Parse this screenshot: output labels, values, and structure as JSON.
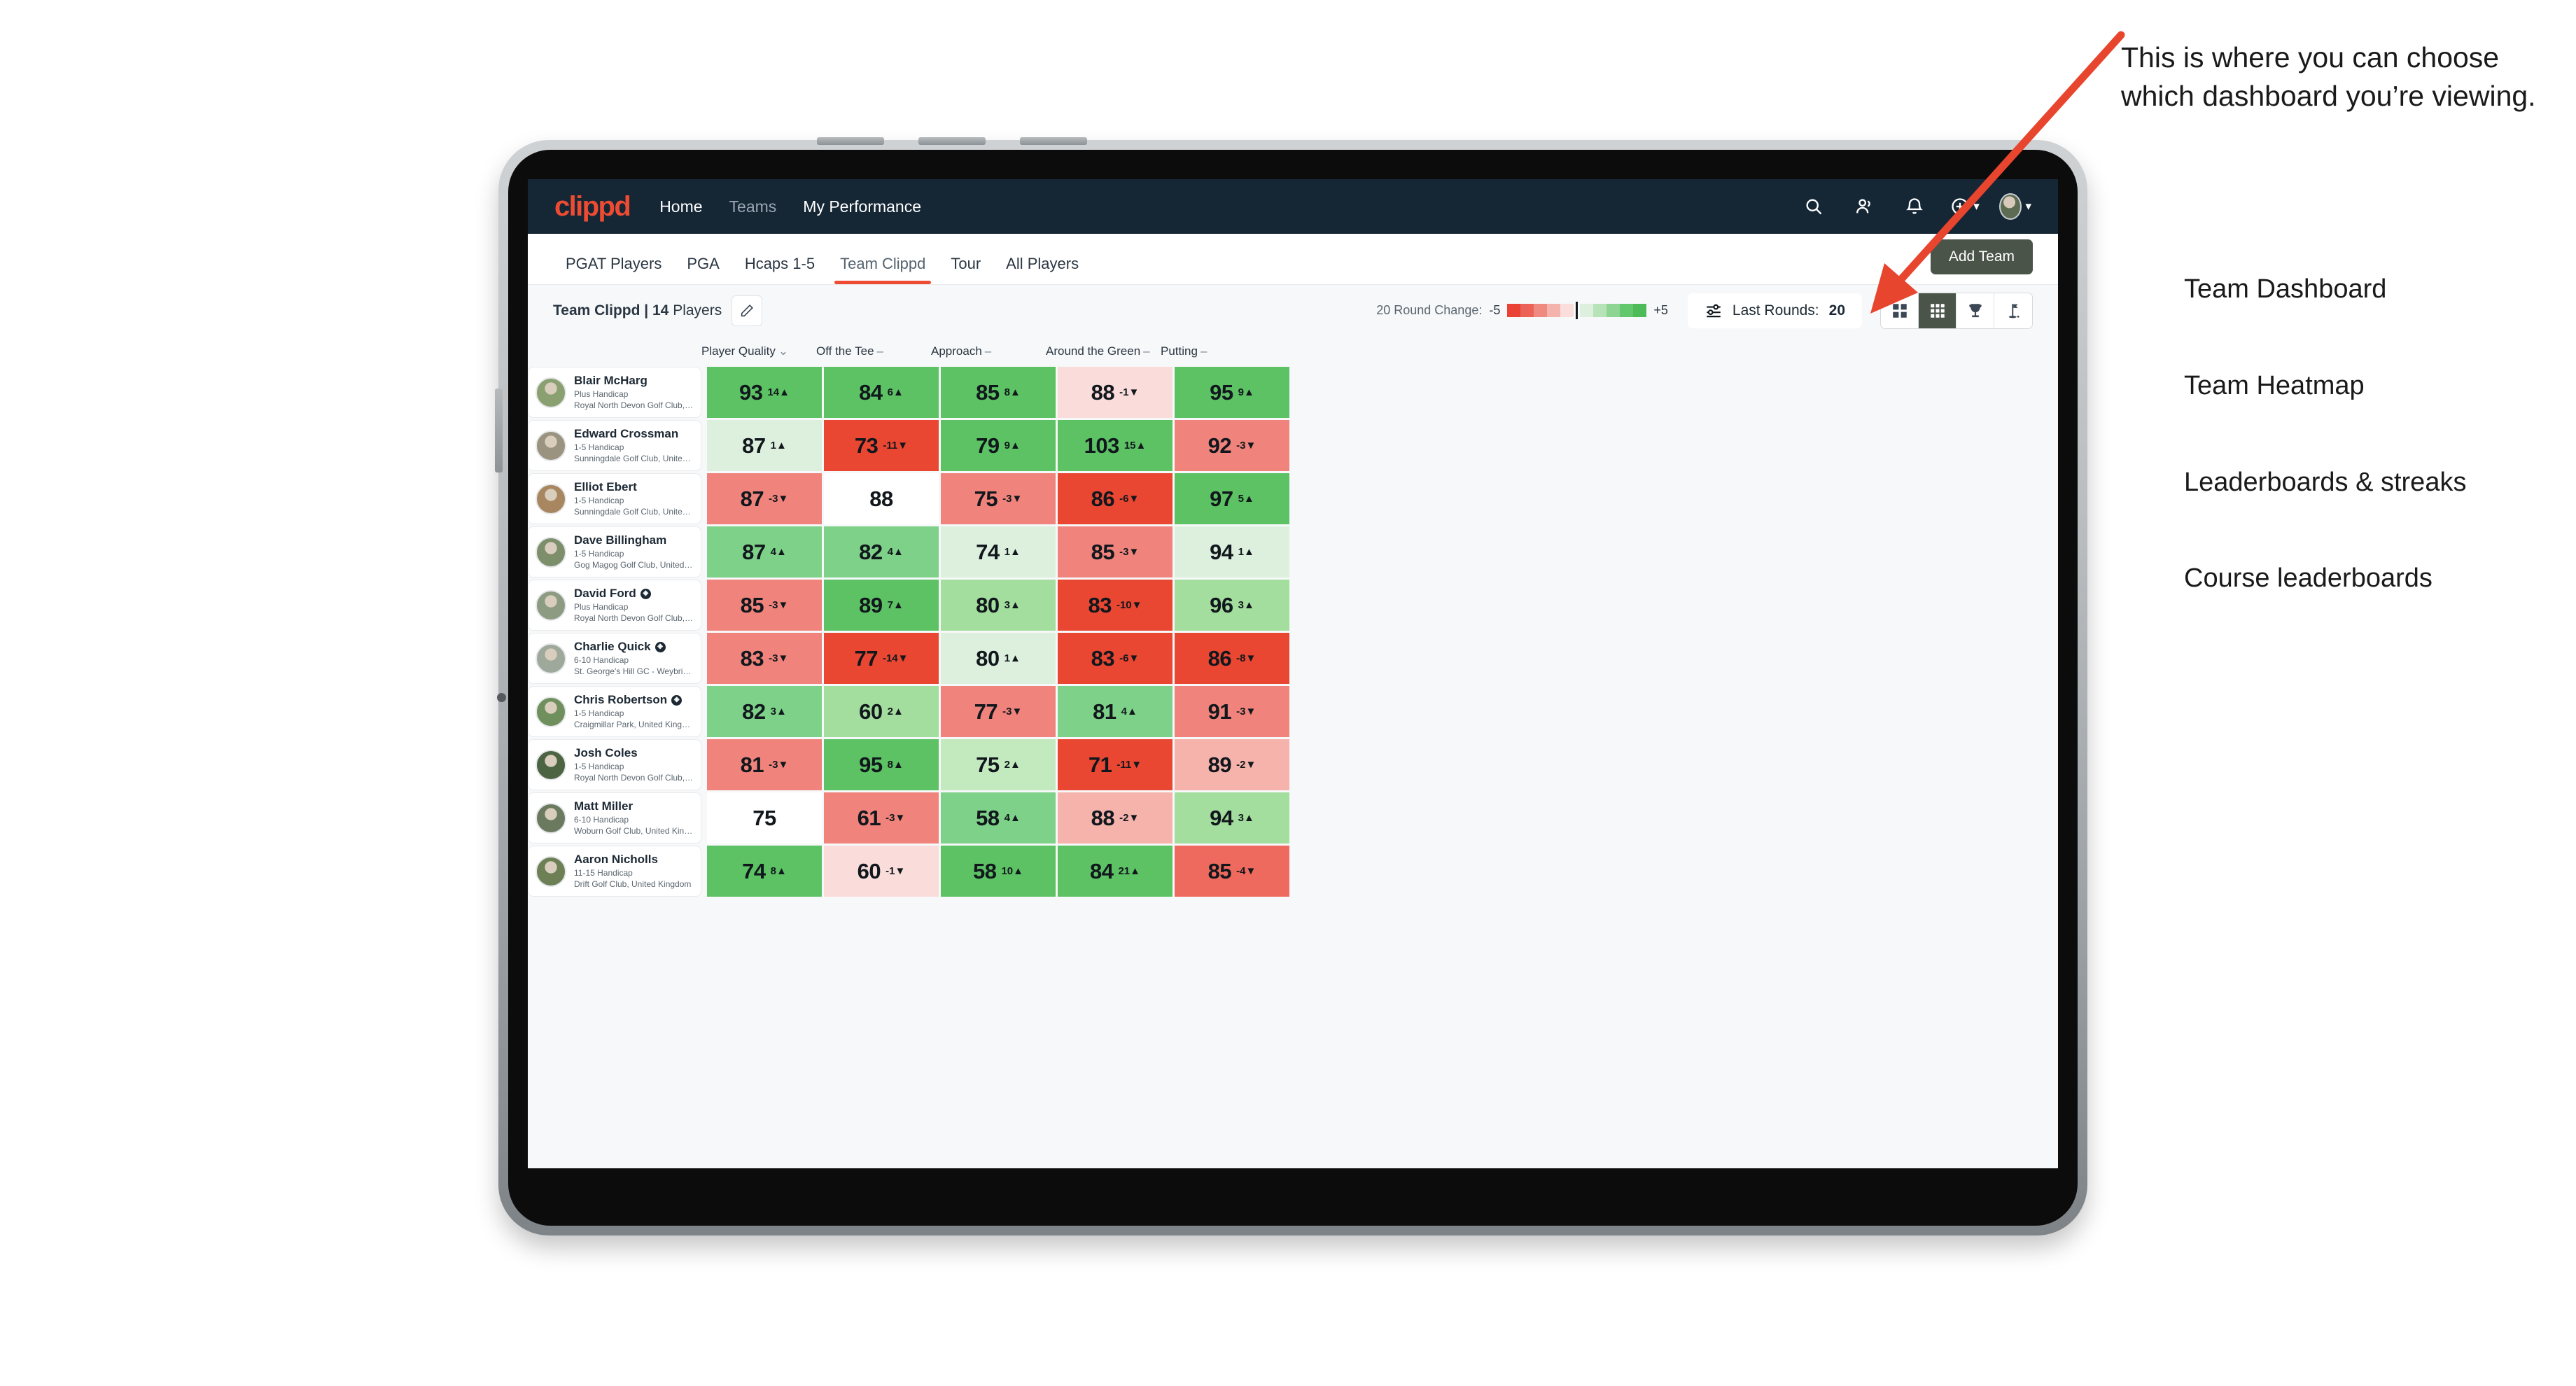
{
  "header": {
    "logo": "clippd",
    "nav": [
      {
        "label": "Home",
        "active": true
      },
      {
        "label": "Teams",
        "active": false
      },
      {
        "label": "My Performance",
        "active": true
      }
    ],
    "icons": [
      {
        "name": "search-icon"
      },
      {
        "name": "people-icon"
      },
      {
        "name": "bell-icon"
      },
      {
        "name": "plus-circle-icon"
      },
      {
        "name": "avatar-icon"
      }
    ]
  },
  "subnav": {
    "tabs": [
      {
        "label": "PGAT Players",
        "active": false
      },
      {
        "label": "PGA",
        "active": false
      },
      {
        "label": "Hcaps 1-5",
        "active": false
      },
      {
        "label": "Team Clippd",
        "active": true
      },
      {
        "label": "Tour",
        "active": false
      },
      {
        "label": "All Players",
        "active": false
      }
    ],
    "add_team_label": "Add Team"
  },
  "toolbar": {
    "team_name": "Team Clippd",
    "team_separator": " | ",
    "player_count": "14",
    "players_word": " Players",
    "edit_icon": "pencil-icon",
    "legend_label": "20 Round Change:",
    "legend_min": "-5",
    "legend_max": "+5",
    "legend_red": [
      "#ea4335",
      "#ec6257",
      "#ef8a81",
      "#f4b3ad",
      "#fadedb"
    ],
    "legend_green": [
      "#ddf0de",
      "#b7e3b9",
      "#8ed593",
      "#63c76d",
      "#4cbb58"
    ],
    "rounds_label": "Last Rounds:",
    "rounds_value": "20",
    "rounds_icon": "sliders-icon",
    "view_toggles": [
      {
        "name": "grid-2x2-icon",
        "label": "Team Dashboard",
        "active": false
      },
      {
        "name": "grid-3x3-icon",
        "label": "Team Heatmap",
        "active": true
      },
      {
        "name": "trophy-icon",
        "label": "Leaderboards & streaks",
        "active": false
      },
      {
        "name": "golf-flag-icon",
        "label": "Course leaderboards",
        "active": false
      }
    ]
  },
  "table": {
    "columns": [
      {
        "label": "Player Quality",
        "indicator": "⌄"
      },
      {
        "label": "Off the Tee",
        "indicator": "–"
      },
      {
        "label": "Approach",
        "indicator": "–"
      },
      {
        "label": "Around the Green",
        "indicator": "–"
      },
      {
        "label": "Putting",
        "indicator": "–"
      }
    ],
    "rows": [
      {
        "name": "Blair McHarg",
        "badge": false,
        "handicap": "Plus Handicap",
        "club": "Royal North Devon Golf Club, United Kingdom",
        "avatar": "#8aa070",
        "cells": [
          {
            "value": "93",
            "delta": "14",
            "dir": "up",
            "bg": "#5cc264"
          },
          {
            "value": "84",
            "delta": "6",
            "dir": "up",
            "bg": "#5cc264"
          },
          {
            "value": "85",
            "delta": "8",
            "dir": "up",
            "bg": "#5cc264"
          },
          {
            "value": "88",
            "delta": "-1",
            "dir": "down",
            "bg": "#fadddb"
          },
          {
            "value": "95",
            "delta": "9",
            "dir": "up",
            "bg": "#5cc264"
          }
        ]
      },
      {
        "name": "Edward Crossman",
        "badge": false,
        "handicap": "1-5 Handicap",
        "club": "Sunningdale Golf Club, United Kingdom",
        "avatar": "#9a9380",
        "cells": [
          {
            "value": "87",
            "delta": "1",
            "dir": "up",
            "bg": "#dcf0dd"
          },
          {
            "value": "73",
            "delta": "-11",
            "dir": "down",
            "bg": "#ea4733"
          },
          {
            "value": "79",
            "delta": "9",
            "dir": "up",
            "bg": "#5cc264"
          },
          {
            "value": "103",
            "delta": "15",
            "dir": "up",
            "bg": "#5cc264"
          },
          {
            "value": "92",
            "delta": "-3",
            "dir": "down",
            "bg": "#f0847c"
          }
        ]
      },
      {
        "name": "Elliot Ebert",
        "badge": false,
        "handicap": "1-5 Handicap",
        "club": "Sunningdale Golf Club, United Kingdom",
        "avatar": "#a8865f",
        "cells": [
          {
            "value": "87",
            "delta": "-3",
            "dir": "down",
            "bg": "#f0847c"
          },
          {
            "value": "88",
            "delta": "",
            "dir": "",
            "bg": "#ffffff"
          },
          {
            "value": "75",
            "delta": "-3",
            "dir": "down",
            "bg": "#f0847c"
          },
          {
            "value": "86",
            "delta": "-6",
            "dir": "down",
            "bg": "#ea4733"
          },
          {
            "value": "97",
            "delta": "5",
            "dir": "up",
            "bg": "#5cc264"
          }
        ]
      },
      {
        "name": "Dave Billingham",
        "badge": false,
        "handicap": "1-5 Handicap",
        "club": "Gog Magog Golf Club, United Kingdom",
        "avatar": "#7d8e6a",
        "cells": [
          {
            "value": "87",
            "delta": "4",
            "dir": "up",
            "bg": "#7ed188"
          },
          {
            "value": "82",
            "delta": "4",
            "dir": "up",
            "bg": "#7ed188"
          },
          {
            "value": "74",
            "delta": "1",
            "dir": "up",
            "bg": "#dcf0dd"
          },
          {
            "value": "85",
            "delta": "-3",
            "dir": "down",
            "bg": "#f0847c"
          },
          {
            "value": "94",
            "delta": "1",
            "dir": "up",
            "bg": "#dcf0dd"
          }
        ]
      },
      {
        "name": "David Ford",
        "badge": true,
        "handicap": "Plus Handicap",
        "club": "Royal North Devon Golf Club, United Kingdom",
        "avatar": "#8d9b83",
        "cells": [
          {
            "value": "85",
            "delta": "-3",
            "dir": "down",
            "bg": "#f0847c"
          },
          {
            "value": "89",
            "delta": "7",
            "dir": "up",
            "bg": "#5cc264"
          },
          {
            "value": "80",
            "delta": "3",
            "dir": "up",
            "bg": "#a3de9e"
          },
          {
            "value": "83",
            "delta": "-10",
            "dir": "down",
            "bg": "#ea4733"
          },
          {
            "value": "96",
            "delta": "3",
            "dir": "up",
            "bg": "#a3de9e"
          }
        ]
      },
      {
        "name": "Charlie Quick",
        "badge": true,
        "handicap": "6-10 Handicap",
        "club": "St. George's Hill GC - Weybridge - Surrey, Uni…",
        "avatar": "#9fa99b",
        "cells": [
          {
            "value": "83",
            "delta": "-3",
            "dir": "down",
            "bg": "#f0847c"
          },
          {
            "value": "77",
            "delta": "-14",
            "dir": "down",
            "bg": "#ea4733"
          },
          {
            "value": "80",
            "delta": "1",
            "dir": "up",
            "bg": "#dcf0dd"
          },
          {
            "value": "83",
            "delta": "-6",
            "dir": "down",
            "bg": "#ea4733"
          },
          {
            "value": "86",
            "delta": "-8",
            "dir": "down",
            "bg": "#ea4733"
          }
        ]
      },
      {
        "name": "Chris Robertson",
        "badge": true,
        "handicap": "1-5 Handicap",
        "club": "Craigmillar Park, United Kingdom",
        "avatar": "#6f8f5c",
        "cells": [
          {
            "value": "82",
            "delta": "3",
            "dir": "up",
            "bg": "#7ed188"
          },
          {
            "value": "60",
            "delta": "2",
            "dir": "up",
            "bg": "#a3de9e"
          },
          {
            "value": "77",
            "delta": "-3",
            "dir": "down",
            "bg": "#f0847c"
          },
          {
            "value": "81",
            "delta": "4",
            "dir": "up",
            "bg": "#7ed188"
          },
          {
            "value": "91",
            "delta": "-3",
            "dir": "down",
            "bg": "#f0847c"
          }
        ]
      },
      {
        "name": "Josh Coles",
        "badge": false,
        "handicap": "1-5 Handicap",
        "club": "Royal North Devon Golf Club, United Kingdom",
        "avatar": "#4c6442",
        "cells": [
          {
            "value": "81",
            "delta": "-3",
            "dir": "down",
            "bg": "#f0847c"
          },
          {
            "value": "95",
            "delta": "8",
            "dir": "up",
            "bg": "#5cc264"
          },
          {
            "value": "75",
            "delta": "2",
            "dir": "up",
            "bg": "#c3e9bf"
          },
          {
            "value": "71",
            "delta": "-11",
            "dir": "down",
            "bg": "#ea4733"
          },
          {
            "value": "89",
            "delta": "-2",
            "dir": "down",
            "bg": "#f5b3ac"
          }
        ]
      },
      {
        "name": "Matt Miller",
        "badge": false,
        "handicap": "6-10 Handicap",
        "club": "Woburn Golf Club, United Kingdom",
        "avatar": "#6b7a5e",
        "cells": [
          {
            "value": "75",
            "delta": "",
            "dir": "",
            "bg": "#ffffff"
          },
          {
            "value": "61",
            "delta": "-3",
            "dir": "down",
            "bg": "#f0847c"
          },
          {
            "value": "58",
            "delta": "4",
            "dir": "up",
            "bg": "#7ed188"
          },
          {
            "value": "88",
            "delta": "-2",
            "dir": "down",
            "bg": "#f5b3ac"
          },
          {
            "value": "94",
            "delta": "3",
            "dir": "up",
            "bg": "#a3de9e"
          }
        ]
      },
      {
        "name": "Aaron Nicholls",
        "badge": false,
        "handicap": "11-15 Handicap",
        "club": "Drift Golf Club, United Kingdom",
        "avatar": "#6d7f55",
        "cells": [
          {
            "value": "74",
            "delta": "8",
            "dir": "up",
            "bg": "#5cc264"
          },
          {
            "value": "60",
            "delta": "-1",
            "dir": "down",
            "bg": "#fadddb"
          },
          {
            "value": "58",
            "delta": "10",
            "dir": "up",
            "bg": "#5cc264"
          },
          {
            "value": "84",
            "delta": "21",
            "dir": "up",
            "bg": "#5cc264"
          },
          {
            "value": "85",
            "delta": "-4",
            "dir": "down",
            "bg": "#ee6a5e"
          }
        ]
      }
    ]
  },
  "annotation": {
    "callout": "This is where you can choose which dashboard you’re viewing.",
    "options": [
      "Team Dashboard",
      "Team Heatmap",
      "Leaderboards & streaks",
      "Course leaderboards"
    ],
    "arrow_color": "#e8452f"
  }
}
